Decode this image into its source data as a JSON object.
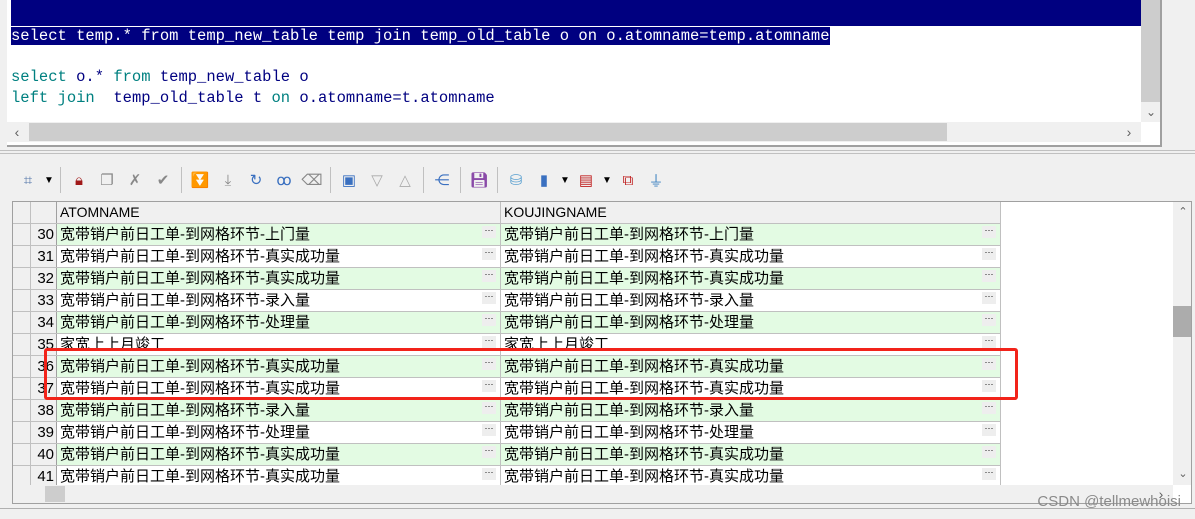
{
  "editor": {
    "line0": "select temp.* from temp_new_table temp join temp_old_table o on o.atomname=temp.atomname",
    "line1": {
      "select": "select",
      "rest1": " o.* ",
      "from": "from",
      "rest2": " temp_new_table o"
    },
    "line2": {
      "left": "left",
      "join": "join",
      "rest1": "  temp_old_table t ",
      "on": "on",
      "rest2": " o.atomname=t.atomname"
    }
  },
  "toolbar": {
    "icons": [
      "select-mode-icon",
      "lock-icon",
      "new-record-icon",
      "delete-record-icon",
      "post-icon",
      "next-record-icon",
      "last-record-icon",
      "refresh-icon",
      "find-icon",
      "clear-icon",
      "single-record-view-icon",
      "sort-desc-icon",
      "sort-asc-icon",
      "query-plan-icon",
      "save-icon",
      "export-icon",
      "chart-icon",
      "grid-options-icon",
      "compare-icon",
      "filter-icon"
    ]
  },
  "grid": {
    "columns": [
      "ATOMNAME",
      "KOUJINGNAME"
    ],
    "rows": [
      {
        "n": "30",
        "a": "宽带销户前日工单-到网格环节-上门量",
        "b": "宽带销户前日工单-到网格环节-上门量"
      },
      {
        "n": "31",
        "a": "宽带销户前日工单-到网格环节-真实成功量",
        "b": "宽带销户前日工单-到网格环节-真实成功量"
      },
      {
        "n": "32",
        "a": "宽带销户前日工单-到网格环节-真实成功量",
        "b": "宽带销户前日工单-到网格环节-真实成功量"
      },
      {
        "n": "33",
        "a": "宽带销户前日工单-到网格环节-录入量",
        "b": "宽带销户前日工单-到网格环节-录入量"
      },
      {
        "n": "34",
        "a": "宽带销户前日工单-到网格环节-处理量",
        "b": "宽带销户前日工单-到网格环节-处理量"
      },
      {
        "n": "35",
        "a": "家宽上上月竣工",
        "b": "家宽上上月竣工"
      },
      {
        "n": "36",
        "a": "宽带销户前日工单-到网格环节-真实成功量",
        "b": "宽带销户前日工单-到网格环节-真实成功量"
      },
      {
        "n": "37",
        "a": "宽带销户前日工单-到网格环节-真实成功量",
        "b": "宽带销户前日工单-到网格环节-真实成功量"
      },
      {
        "n": "38",
        "a": "宽带销户前日工单-到网格环节-录入量",
        "b": "宽带销户前日工单-到网格环节-录入量"
      },
      {
        "n": "39",
        "a": "宽带销户前日工单-到网格环节-处理量",
        "b": "宽带销户前日工单-到网格环节-处理量"
      },
      {
        "n": "40",
        "a": "宽带销户前日工单-到网格环节-真实成功量",
        "b": "宽带销户前日工单-到网格环节-真实成功量"
      },
      {
        "n": "41",
        "a": "宽带销户前日工单-到网格环节-真实成功量",
        "b": "宽带销户前日工单-到网格环节-真实成功量"
      }
    ],
    "ellipsis": "···",
    "row_color": "#e3fbe3",
    "highlight_color": "#f2231a"
  },
  "watermark": "CSDN @tellmewhoisi"
}
